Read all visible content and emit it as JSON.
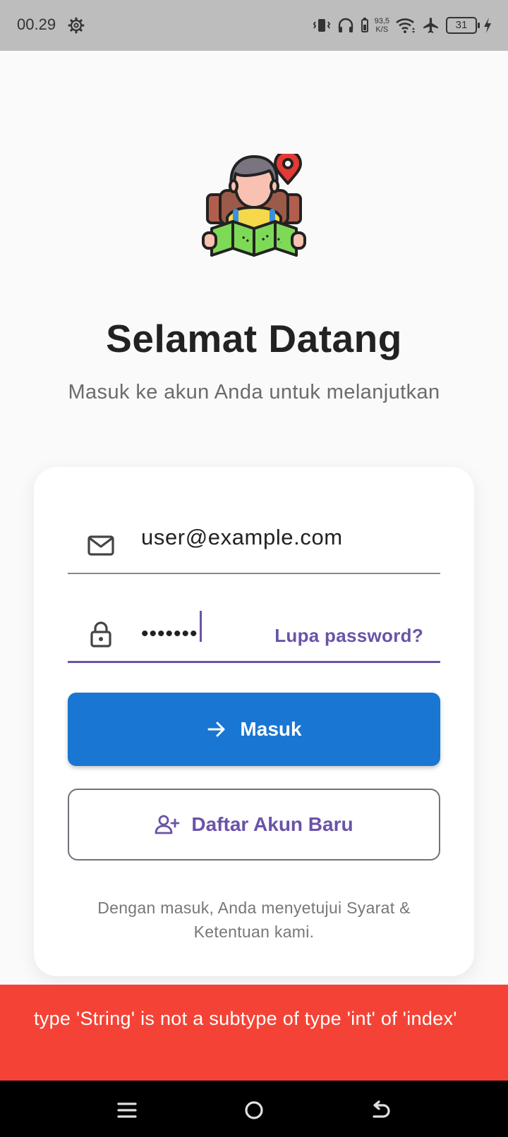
{
  "status_bar": {
    "time": "00.29",
    "net_speed_value": "93,5",
    "net_speed_unit": "K/S",
    "battery": "31",
    "icons": [
      "settings-icon",
      "vibrate-icon",
      "headphones-icon",
      "network-speed",
      "wifi-icon",
      "airplane-icon",
      "battery-icon",
      "charging-icon"
    ]
  },
  "hero": {
    "icon": "traveler-with-map-icon"
  },
  "header": {
    "title": "Selamat Datang",
    "subtitle": "Masuk ke akun Anda untuk melanjutkan"
  },
  "form": {
    "email": {
      "icon": "mail-icon",
      "value": "user@example.com"
    },
    "password": {
      "icon": "lock-icon",
      "value": "•••••••",
      "forgot_label": "Lupa password?"
    },
    "login_button": {
      "icon": "arrow-right-icon",
      "label": "Masuk"
    },
    "register_button": {
      "icon": "person-add-icon",
      "label": "Daftar Akun Baru"
    },
    "terms": "Dengan masuk, Anda menyetujui Syarat & Ketentuan kami."
  },
  "error_banner": {
    "message": "type 'String' is not a subtype of type 'int' of 'index'"
  },
  "colors": {
    "primary_blue": "#1976d2",
    "accent_purple": "#6a53a8",
    "error_red": "#f44336",
    "status_bar_bg": "#bdbdbd"
  },
  "nav_bar": {
    "buttons": [
      "menu-icon",
      "home-icon",
      "back-icon"
    ]
  }
}
